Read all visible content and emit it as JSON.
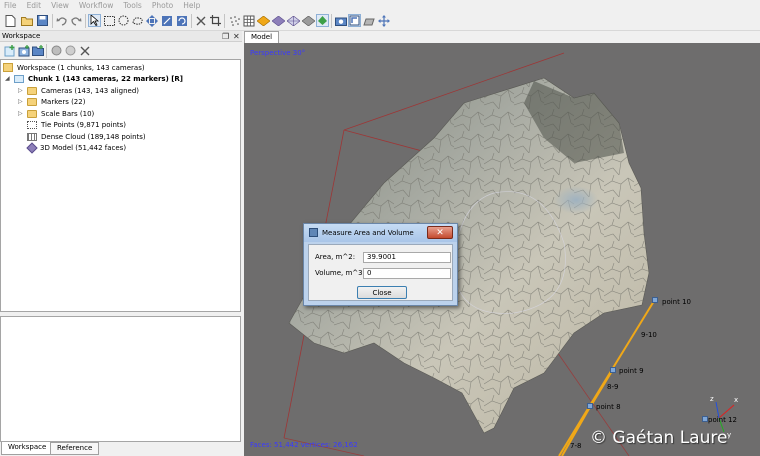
{
  "menu": [
    "File",
    "Edit",
    "View",
    "Workflow",
    "Tools",
    "Photo",
    "Help"
  ],
  "workspace_panel": {
    "title": "Workspace",
    "tree": [
      {
        "label": "Workspace (1 chunks, 143 cameras)",
        "icon": "workspace-icon",
        "bold": false
      },
      {
        "label": "Chunk 1 (143 cameras, 22 markers) [R]",
        "icon": "chunk-icon",
        "bold": true
      },
      {
        "label": "Cameras (143, 143 aligned)",
        "icon": "folder-icon",
        "bold": false
      },
      {
        "label": "Markers (22)",
        "icon": "folder-icon",
        "bold": false
      },
      {
        "label": "Scale Bars (10)",
        "icon": "folder-icon",
        "bold": false
      },
      {
        "label": "Tie Points (9,871 points)",
        "icon": "tie-points-icon",
        "bold": false
      },
      {
        "label": "Dense Cloud (189,148 points)",
        "icon": "dense-cloud-icon",
        "bold": false
      },
      {
        "label": "3D Model (51,442 faces)",
        "icon": "model-icon",
        "bold": false
      }
    ],
    "tabs": [
      "Workspace",
      "Reference"
    ]
  },
  "model_view": {
    "tab": "Model",
    "projection": "Perspective 30°",
    "stats": "Faces: 51,442 vertices: 26,162",
    "markers": [
      {
        "label": "point 10"
      },
      {
        "label": "9-10"
      },
      {
        "label": "point 9"
      },
      {
        "label": "8-9"
      },
      {
        "label": "point 8"
      },
      {
        "label": "7-8"
      },
      {
        "label": "point 12"
      }
    ],
    "axes": {
      "x": "x",
      "y": "y",
      "z": "z"
    },
    "watermark": "© Gaétan Laure",
    "colors": {
      "background": "#6e6d6d",
      "scale_bar": "#f0a818",
      "bounding_box": "#b02020",
      "overlay_text": "#3a3aff"
    }
  },
  "dialog": {
    "title": "Measure Area and Volume",
    "area_label": "Area, m^2:",
    "area_value": "39.9001",
    "volume_label": "Volume, m^3:",
    "volume_value": "0",
    "close_button": "Close"
  }
}
